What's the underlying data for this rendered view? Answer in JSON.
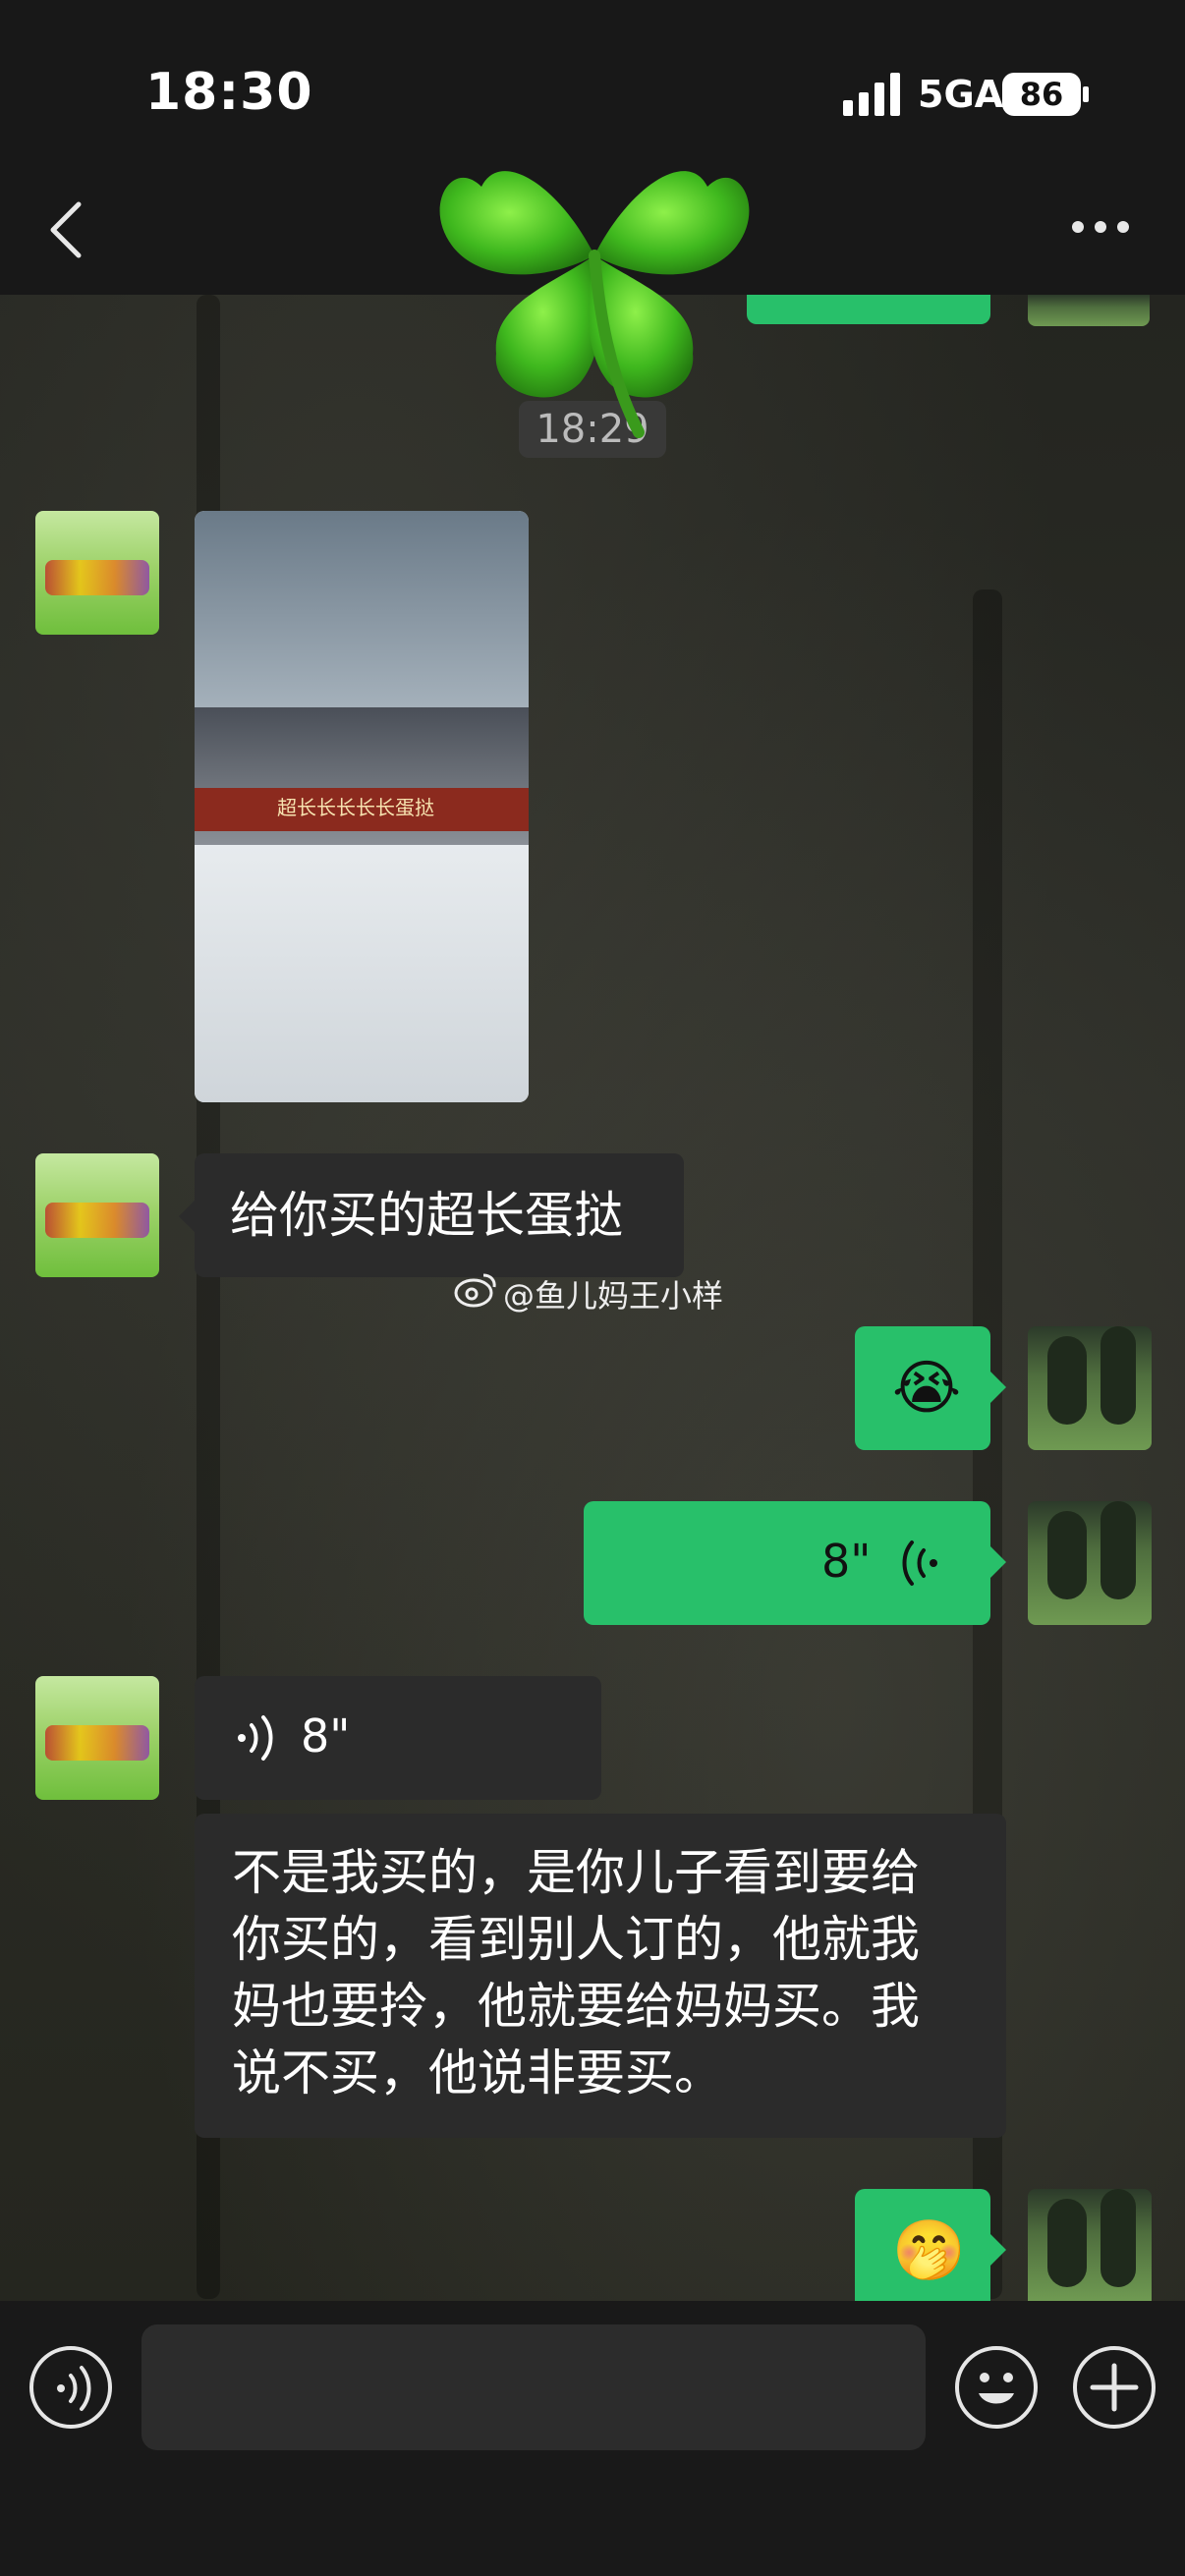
{
  "status_bar": {
    "time": "18:30",
    "network": "5GA",
    "battery": "86"
  },
  "chat": {
    "timestamp": "18:29",
    "messages": {
      "photo_alt": "超长蛋挞照片",
      "text1": "给你买的超长蛋挞",
      "emoji1": "😭",
      "voice_out": "8\"",
      "voice_in": "8\"",
      "text2_lines": [
        "不是我买的，是你儿子看到要给",
        "你买的，看到别人订的，他就我",
        "妈也要拎，他就要给妈妈买。我",
        "说不买，他说非要买。"
      ],
      "emoji2": "🤭"
    },
    "photo_sign": "超长长长长长蛋挞"
  },
  "watermark": "@鱼儿妈王小样",
  "colors": {
    "accent_green": "#28c06a",
    "bubble_dark": "#2b2b2b",
    "bar_bg": "#181818"
  },
  "icons": [
    "back-icon",
    "more-icon",
    "clover-sticker",
    "voice-icon",
    "emoji-icon",
    "plus-icon",
    "weibo-icon"
  ]
}
